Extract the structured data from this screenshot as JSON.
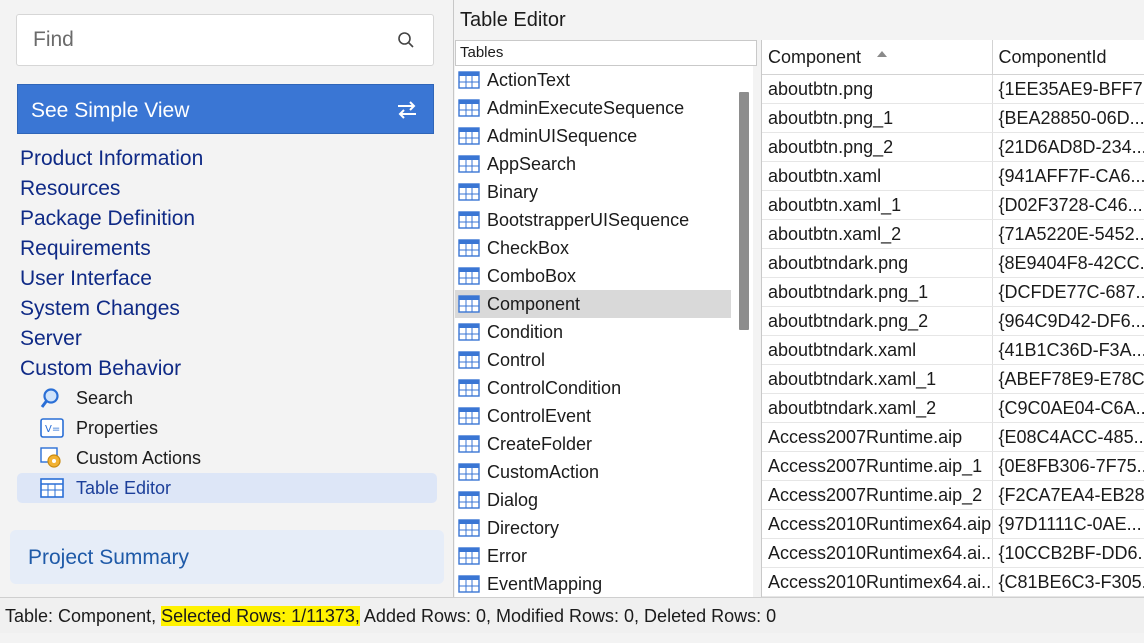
{
  "search": {
    "placeholder": "Find"
  },
  "simple_view": {
    "label": "See Simple View"
  },
  "nav": {
    "items": [
      "Product Information",
      "Resources",
      "Package Definition",
      "Requirements",
      "User Interface",
      "System Changes",
      "Server",
      "Custom Behavior"
    ],
    "sub_items": [
      {
        "label": "Search",
        "icon": "search-icon"
      },
      {
        "label": "Properties",
        "icon": "properties-icon"
      },
      {
        "label": "Custom Actions",
        "icon": "custom-actions-icon"
      },
      {
        "label": "Table Editor",
        "icon": "table-icon",
        "selected": true
      }
    ]
  },
  "project_summary": {
    "label": "Project Summary"
  },
  "editor": {
    "title": "Table Editor",
    "tables_header": "Tables"
  },
  "tables": [
    "ActionText",
    "AdminExecuteSequence",
    "AdminUISequence",
    "AppSearch",
    "Binary",
    "BootstrapperUISequence",
    "CheckBox",
    "ComboBox",
    "Component",
    "Condition",
    "Control",
    "ControlCondition",
    "ControlEvent",
    "CreateFolder",
    "CustomAction",
    "Dialog",
    "Directory",
    "Error",
    "EventMapping"
  ],
  "selected_table": "Component",
  "grid": {
    "columns": [
      "Component",
      "ComponentId"
    ],
    "rows": [
      [
        "aboutbtn.png",
        "{1EE35AE9-BFF7..."
      ],
      [
        "aboutbtn.png_1",
        "{BEA28850-06D..."
      ],
      [
        "aboutbtn.png_2",
        "{21D6AD8D-234..."
      ],
      [
        "aboutbtn.xaml",
        "{941AFF7F-CA6..."
      ],
      [
        "aboutbtn.xaml_1",
        "{D02F3728-C46..."
      ],
      [
        "aboutbtn.xaml_2",
        "{71A5220E-5452..."
      ],
      [
        "aboutbtndark.png",
        "{8E9404F8-42CC..."
      ],
      [
        "aboutbtndark.png_1",
        "{DCFDE77C-687..."
      ],
      [
        "aboutbtndark.png_2",
        "{964C9D42-DF6..."
      ],
      [
        "aboutbtndark.xaml",
        "{41B1C36D-F3A..."
      ],
      [
        "aboutbtndark.xaml_1",
        "{ABEF78E9-E78C..."
      ],
      [
        "aboutbtndark.xaml_2",
        "{C9C0AE04-C6A..."
      ],
      [
        "Access2007Runtime.aip",
        "{E08C4ACC-485..."
      ],
      [
        "Access2007Runtime.aip_1",
        "{0E8FB306-7F75..."
      ],
      [
        "Access2007Runtime.aip_2",
        "{F2CA7EA4-EB28..."
      ],
      [
        "Access2010Runtimex64.aip",
        "{97D1111C-0AE..."
      ],
      [
        "Access2010Runtimex64.ai...",
        "{10CCB2BF-DD6..."
      ],
      [
        "Access2010Runtimex64.ai...",
        "{C81BE6C3-F305..."
      ]
    ]
  },
  "status": {
    "table": "Table: Component,",
    "selected": "Selected Rows: 1/11373,",
    "rest": "Added Rows: 0, Modified Rows: 0, Deleted Rows: 0"
  },
  "colors": {
    "accent": "#3a76d4",
    "nav_text": "#0f2a86",
    "highlight": "#fff200"
  }
}
